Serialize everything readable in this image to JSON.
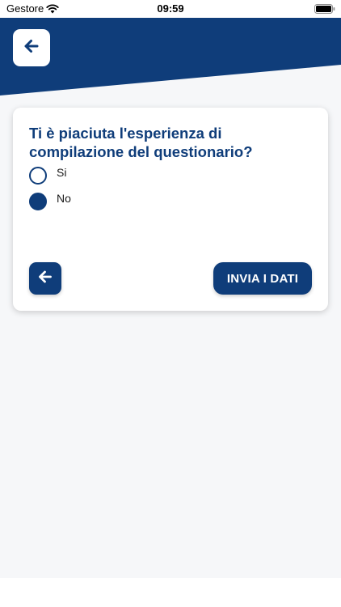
{
  "status_bar": {
    "carrier": "Gestore",
    "time": "09:59",
    "wifi_icon": "wifi-icon",
    "battery_icon": "battery-icon"
  },
  "header": {
    "back_icon": "arrow-left-icon"
  },
  "survey": {
    "question": "Ti è piaciuta l'esperienza di compilazione del questionario?",
    "options": [
      {
        "label": "Si",
        "selected": false
      },
      {
        "label": "No",
        "selected": true
      }
    ],
    "back_icon": "arrow-left-icon",
    "submit_label": "INVIA I DATI"
  },
  "colors": {
    "primary": "#0f3d7a",
    "background": "#f6f7f9",
    "card": "#ffffff"
  }
}
